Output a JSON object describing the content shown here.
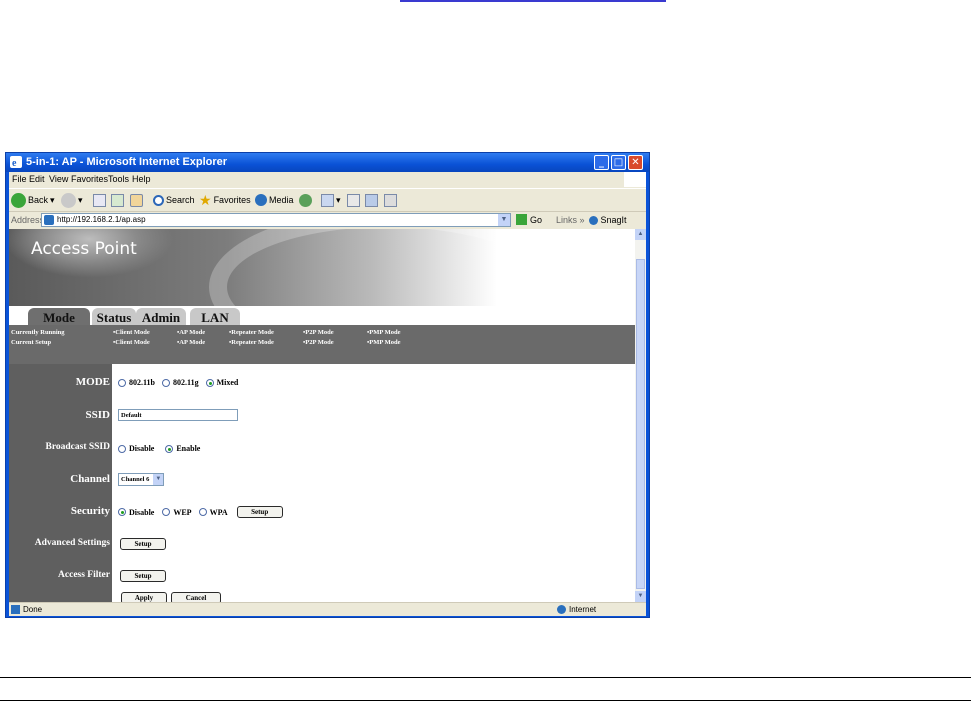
{
  "window": {
    "title": "5-in-1: AP - Microsoft Internet Explorer",
    "menu": [
      "File",
      "Edit",
      "View",
      "Favorites",
      "Tools",
      "Help"
    ],
    "toolbar": {
      "back": "Back",
      "search": "Search",
      "favorites": "Favorites",
      "media": "Media"
    },
    "address": {
      "label": "Address",
      "url": "http://192.168.2.1/ap.asp",
      "go": "Go",
      "links": "Links",
      "snagit": "SnagIt"
    },
    "status": {
      "left": "Done",
      "zone": "Internet"
    }
  },
  "page": {
    "banner_title": "Access Point",
    "tabs": [
      "Mode",
      "Status",
      "Admin",
      "LAN"
    ],
    "mode_bar": {
      "row1_label": "Currently Running",
      "row2_label": "Current Setup",
      "modes": [
        "•Client Mode",
        "•AP Mode",
        "•Repeater Mode",
        "•P2P Mode",
        "•PMP Mode"
      ]
    },
    "form": {
      "mode": {
        "label": "MODE",
        "options": [
          "802.11b",
          "802.11g",
          "Mixed"
        ],
        "selected": "Mixed"
      },
      "ssid": {
        "label": "SSID",
        "value": "Default"
      },
      "broadcast": {
        "label": "Broadcast SSID",
        "options": [
          "Disable",
          "Enable"
        ],
        "selected": "Enable"
      },
      "channel": {
        "label": "Channel",
        "value": "Channel 6"
      },
      "security": {
        "label": "Security",
        "options": [
          "Disable",
          "WEP",
          "WPA"
        ],
        "selected": "Disable",
        "button": "Setup"
      },
      "advanced": {
        "label": "Advanced Settings",
        "button": "Setup"
      },
      "access_filter": {
        "label": "Access Filter",
        "button": "Setup"
      },
      "apply": "Apply",
      "cancel": "Cancel"
    }
  }
}
